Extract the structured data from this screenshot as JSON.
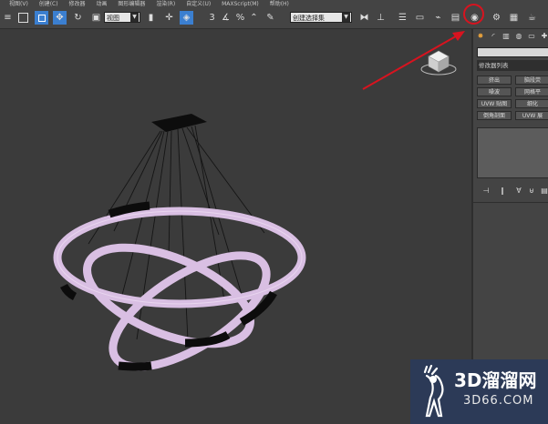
{
  "menu": {
    "items": [
      "视图(V)",
      "创建(C)",
      "修改器",
      "动画",
      "图形编辑器",
      "渲染(R)",
      "自定义(U)",
      "MAXScript(M)",
      "帮助(H)"
    ]
  },
  "toolbar": {
    "view_combo": "视图",
    "selection_set_combo": "创建选择集",
    "highlighted_tool": "material-editor-icon",
    "highlight_color": "#d8131f"
  },
  "command_panel": {
    "modifier_list": "修改器列表",
    "modifier_buttons": [
      "挤出",
      "脑段荧",
      "噪波",
      "网格平",
      "UVW 贴图",
      "细化",
      "倒角剖面",
      "UVW 展"
    ]
  },
  "scene": {
    "ring_color": "#d9bfe3",
    "cable_color": "#141414"
  },
  "watermark": {
    "main": "3D溜溜网",
    "sub": "3D66.COM"
  }
}
